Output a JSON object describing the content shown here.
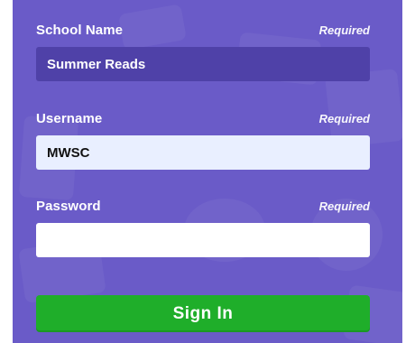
{
  "form": {
    "school": {
      "label": "School Name",
      "required": "Required",
      "value": "Summer Reads"
    },
    "username": {
      "label": "Username",
      "required": "Required",
      "value": "MWSC"
    },
    "password": {
      "label": "Password",
      "required": "Required",
      "value": ""
    },
    "submit_label": "Sign In"
  },
  "colors": {
    "background": "#6a5bc8",
    "school_field": "#4f41a8",
    "username_field": "#e9efff",
    "submit_button": "#1fae2a"
  }
}
